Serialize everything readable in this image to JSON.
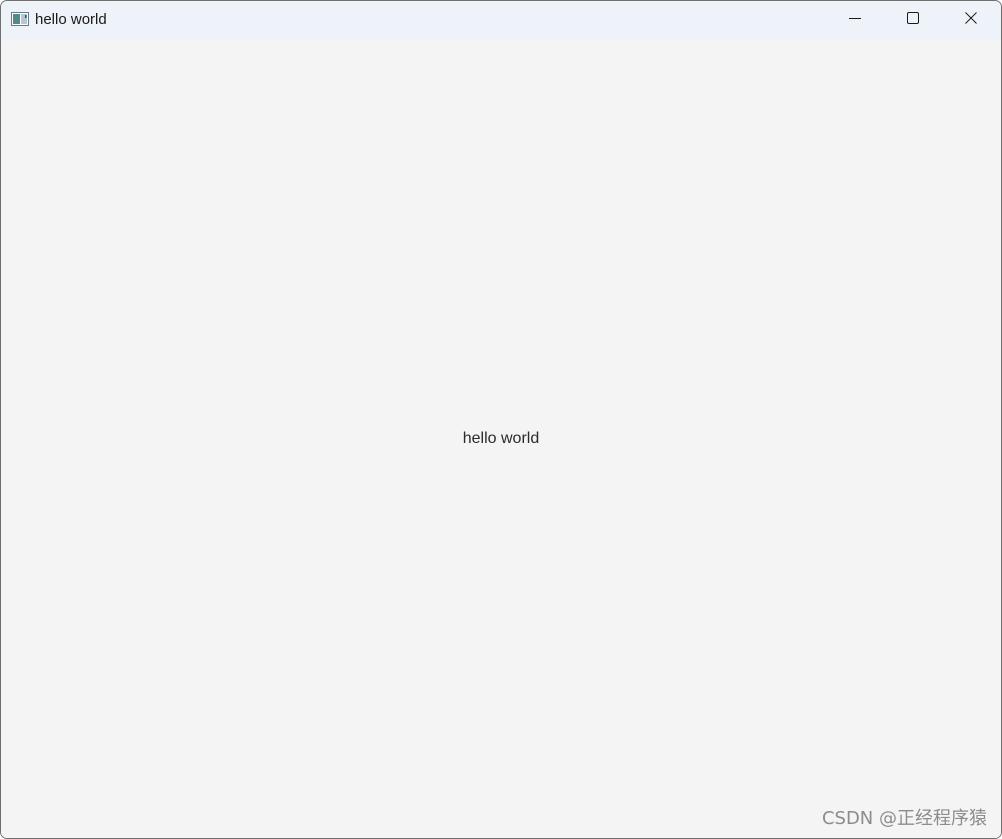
{
  "window": {
    "title": "hello world",
    "icon": "app-window-icon",
    "controls": {
      "minimize_icon": "minimize-icon",
      "maximize_icon": "maximize-icon",
      "close_icon": "close-icon"
    }
  },
  "content": {
    "label": "hello world"
  },
  "watermark": {
    "text": "CSDN @正经程序猿"
  },
  "colors": {
    "titlebar": "#eef2f9",
    "background": "#f4f4f4",
    "text": "#2b2b2b"
  }
}
